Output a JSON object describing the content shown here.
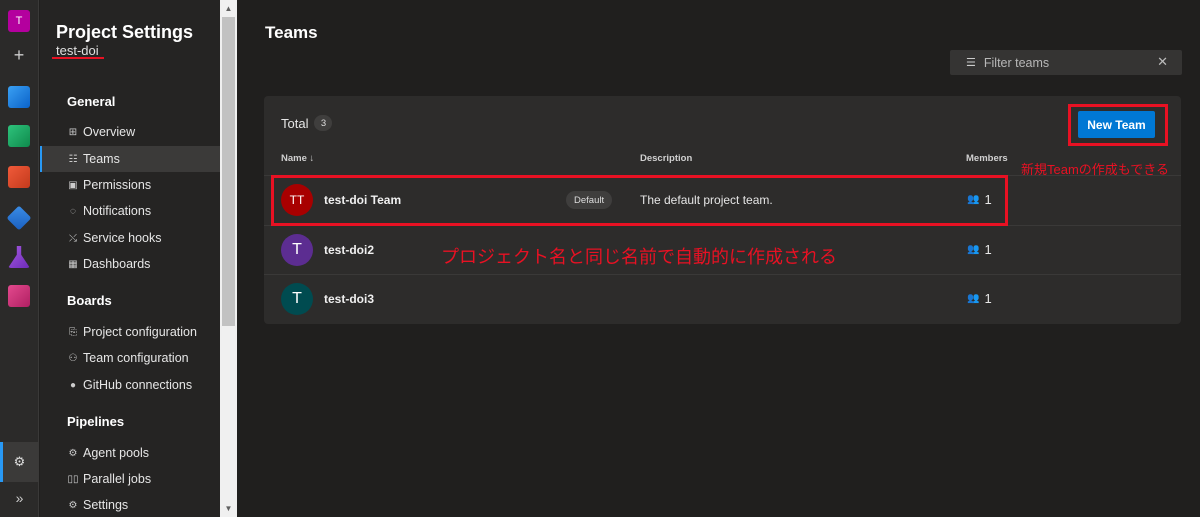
{
  "rail": {
    "org_initial": "T",
    "plus": "+",
    "settings_glyph": "⚙",
    "expand_glyph": "»",
    "services": [
      "overview-icon",
      "boards-icon",
      "repos-icon",
      "pipelines-icon",
      "test-plans-icon",
      "artifacts-icon"
    ]
  },
  "nav": {
    "title": "Project Settings",
    "project": "test-doi",
    "sections": {
      "general": "General",
      "boards": "Boards",
      "pipelines": "Pipelines"
    },
    "items": {
      "overview": "Overview",
      "teams": "Teams",
      "permissions": "Permissions",
      "notifications": "Notifications",
      "service_hooks": "Service hooks",
      "dashboards": "Dashboards",
      "project_configuration": "Project configuration",
      "team_configuration": "Team configuration",
      "github_connections": "GitHub connections",
      "agent_pools": "Agent pools",
      "parallel_jobs": "Parallel jobs",
      "settings": "Settings"
    },
    "selected": "teams"
  },
  "main": {
    "title": "Teams",
    "filter_placeholder": "Filter teams",
    "total_label": "Total",
    "total_count": "3",
    "new_team_label": "New Team",
    "columns": {
      "name": "Name ↓",
      "description": "Description",
      "members": "Members"
    },
    "teams": [
      {
        "initials": "TT",
        "name": "test-doi Team",
        "badge": "Default",
        "description": "The default project team.",
        "members": "1",
        "color": "#a80000"
      },
      {
        "initials": "T",
        "name": "test-doi2",
        "badge": "",
        "description": "",
        "members": "1",
        "color": "#5c2d91"
      },
      {
        "initials": "T",
        "name": "test-doi3",
        "badge": "",
        "description": "",
        "members": "1",
        "color": "#004b50"
      }
    ]
  },
  "annotations": {
    "new_team_note": "新規Teamの作成もできる",
    "default_team_note": "プロジェクト名と同じ名前で自動的に作成される",
    "color": "#e81123"
  }
}
